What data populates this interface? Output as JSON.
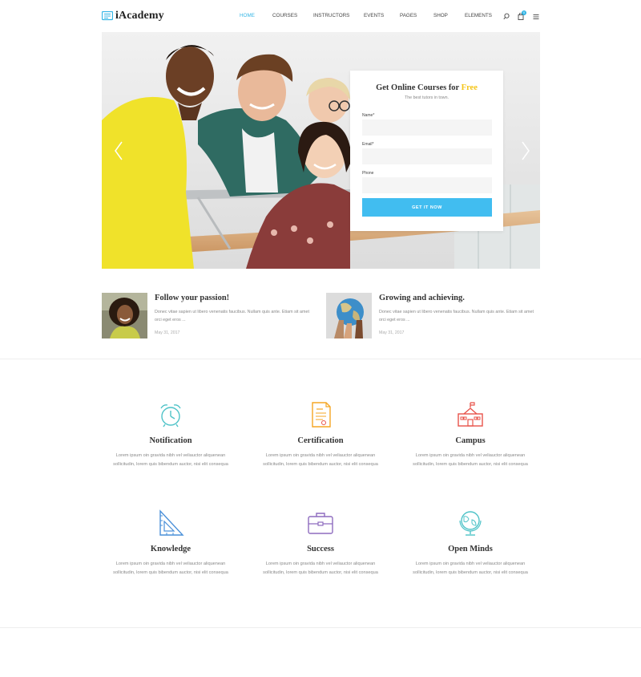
{
  "brand": {
    "name": "iAcademy"
  },
  "nav": {
    "items": [
      {
        "label": "HOME",
        "active": true
      },
      {
        "label": "COURSES",
        "active": false
      },
      {
        "label": "INSTRUCTORS",
        "active": false
      },
      {
        "label": "EVENTS",
        "active": false
      },
      {
        "label": "PAGES",
        "active": false
      },
      {
        "label": "SHOP",
        "active": false
      },
      {
        "label": "ELEMENTS",
        "active": false
      }
    ],
    "cart_count": "0",
    "icons": [
      "search-icon",
      "cart-icon",
      "menu-icon"
    ]
  },
  "hero": {
    "form": {
      "title_main": "Get Online Courses for ",
      "title_accent": "Free",
      "subtitle": "The best tutors in town.",
      "fields": [
        {
          "label": "Name*",
          "value": ""
        },
        {
          "label": "Email*",
          "value": ""
        },
        {
          "label": "Phone",
          "value": ""
        }
      ],
      "button": "GET IT NOW"
    }
  },
  "posts": [
    {
      "title": "Follow your passion!",
      "excerpt": "Donec vitae sapien ut libero venenatis faucibus. Nullam quis ante. Etiam sit amet orci eget eros ...",
      "date": "May 31, 2017"
    },
    {
      "title": "Growing and achieving.",
      "excerpt": "Donec vitae sapien ut libero venenatis faucibus. Nullam quis ante. Etiam sit amet orci eget eros ...",
      "date": "May 31, 2017"
    }
  ],
  "features": [
    {
      "title": "Notification",
      "icon": "alarm-clock-icon",
      "text": "Lorem ipsum oin gravida nibh vel veliauctor aliquenean sollicitudin, lorem quis bibendum auctor, nisi elit consequa"
    },
    {
      "title": "Certification",
      "icon": "certificate-icon",
      "text": "Lorem ipsum oin gravida nibh vel veliauctor aliquenean sollicitudin, lorem quis bibendum auctor, nisi elit consequa"
    },
    {
      "title": "Campus",
      "icon": "school-building-icon",
      "text": "Lorem ipsum oin gravida nibh vel veliauctor aliquenean sollicitudin, lorem quis bibendum auctor, nisi elit consequa"
    },
    {
      "title": "Knowledge",
      "icon": "set-square-icon",
      "text": "Lorem ipsum oin gravida nibh vel veliauctor aliquenean sollicitudin, lorem quis bibendum auctor, nisi elit consequa"
    },
    {
      "title": "Success",
      "icon": "briefcase-icon",
      "text": "Lorem ipsum oin gravida nibh vel veliauctor aliquenean sollicitudin, lorem quis bibendum auctor, nisi elit consequa"
    },
    {
      "title": "Open Minds",
      "icon": "globe-icon",
      "text": "Lorem ipsum oin gravida nibh vel veliauctor aliquenean sollicitudin, lorem quis bibendum auctor, nisi elit consequa"
    }
  ],
  "colors": {
    "accent": "#33b5e5",
    "button": "#41bdf0",
    "highlight": "#f5c518",
    "icon_teal": "#4fc3c8",
    "icon_orange": "#f5a623",
    "icon_red": "#e8534a",
    "icon_blue": "#4a90d9",
    "icon_purple": "#8e6bbf"
  }
}
